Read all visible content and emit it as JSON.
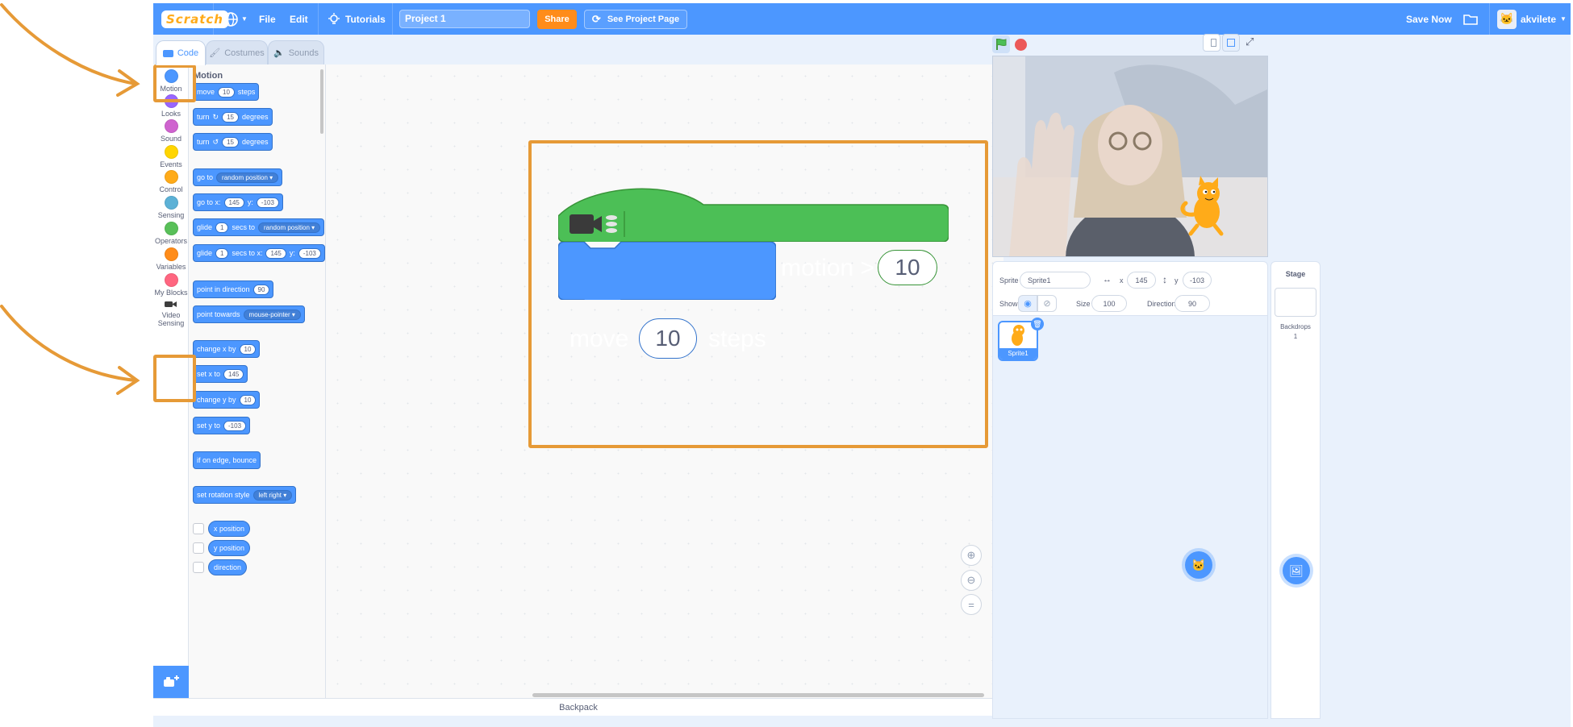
{
  "menubar": {
    "logo": "Scratch",
    "file": "File",
    "edit": "Edit",
    "tutorials": "Tutorials",
    "project_title": "Project 1",
    "share": "Share",
    "see_project_page": "See Project Page",
    "save_now": "Save Now",
    "username": "akvilete"
  },
  "tabs": [
    {
      "label": "Code"
    },
    {
      "label": "Costumes"
    },
    {
      "label": "Sounds"
    }
  ],
  "categories": [
    {
      "label": "Motion",
      "color": "#4c97ff"
    },
    {
      "label": "Looks",
      "color": "#9966ff"
    },
    {
      "label": "Sound",
      "color": "#cf63cf"
    },
    {
      "label": "Events",
      "color": "#ffd500"
    },
    {
      "label": "Control",
      "color": "#ffab19"
    },
    {
      "label": "Sensing",
      "color": "#5cb1d6"
    },
    {
      "label": "Operators",
      "color": "#59c059"
    },
    {
      "label": "Variables",
      "color": "#ff8c1a"
    },
    {
      "label": "My Blocks",
      "color": "#ff6680"
    },
    {
      "label": "Video Sensing",
      "color": ""
    }
  ],
  "palette": {
    "title": "Motion",
    "move": {
      "pre": "move",
      "num": "10",
      "post": "steps"
    },
    "turn_right": {
      "pre": "turn",
      "num": "15",
      "post": "degrees"
    },
    "turn_left": {
      "pre": "turn",
      "num": "15",
      "post": "degrees"
    },
    "goto": {
      "pre": "go to",
      "dd": "random position"
    },
    "goto_xy": {
      "pre": "go to x:",
      "x": "145",
      "mid": "y:",
      "y": "-103"
    },
    "glide_to": {
      "pre": "glide",
      "num": "1",
      "mid": "secs to",
      "dd": "random position"
    },
    "glide_xy": {
      "pre": "glide",
      "num": "1",
      "mid": "secs to x:",
      "x": "145",
      "mid2": "y:",
      "y": "-103"
    },
    "point_dir": {
      "pre": "point in direction",
      "num": "90"
    },
    "point_towards": {
      "pre": "point towards",
      "dd": "mouse-pointer"
    },
    "change_x": {
      "pre": "change x by",
      "num": "10"
    },
    "set_x": {
      "pre": "set x to",
      "num": "145"
    },
    "change_y": {
      "pre": "change y by",
      "num": "10"
    },
    "set_y": {
      "pre": "set y to",
      "num": "-103"
    },
    "bounce": "if on edge, bounce",
    "rotation": {
      "pre": "set rotation style",
      "dd": "left right"
    },
    "reporters": [
      "x position",
      "y position",
      "direction"
    ]
  },
  "workspace": {
    "hat_label": "when video motion >",
    "hat_value": "10",
    "move_pre": "move",
    "move_value": "10",
    "move_post": "steps",
    "hat_color": "#4cbf56",
    "motion_color": "#4c97ff"
  },
  "backpack": "Backpack",
  "sprite_info": {
    "sprite_label": "Sprite",
    "sprite_name": "Sprite1",
    "x_label": "x",
    "x_value": "145",
    "y_label": "y",
    "y_value": "-103",
    "show_label": "Show",
    "size_label": "Size",
    "size_value": "100",
    "direction_label": "Direction",
    "direction_value": "90"
  },
  "sprites": [
    {
      "name": "Sprite1"
    }
  ],
  "stage_panel": {
    "title": "Stage",
    "backdrops_label": "Backdrops",
    "backdrops_count": "1"
  },
  "colors": {
    "accent": "#4c97ff",
    "annotation": "#e69a37",
    "share": "#ff8c1a"
  }
}
